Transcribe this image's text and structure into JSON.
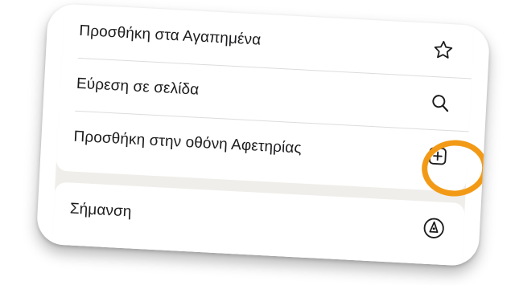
{
  "menu": {
    "items": [
      {
        "label": "Προσθήκη στα Αγαπημένα",
        "icon": "star-icon"
      },
      {
        "label": "Εύρεση σε σελίδα",
        "icon": "search-icon"
      },
      {
        "label": "Προσθήκη στην οθόνη Αφετηρίας",
        "icon": "add-square-icon",
        "highlighted": true
      },
      {
        "label": "Σήμανση",
        "icon": "markup-pen-icon"
      }
    ]
  },
  "colors": {
    "highlight": "#f29a16",
    "text": "#1c1c1e",
    "grouped_background": "#efeeea"
  }
}
